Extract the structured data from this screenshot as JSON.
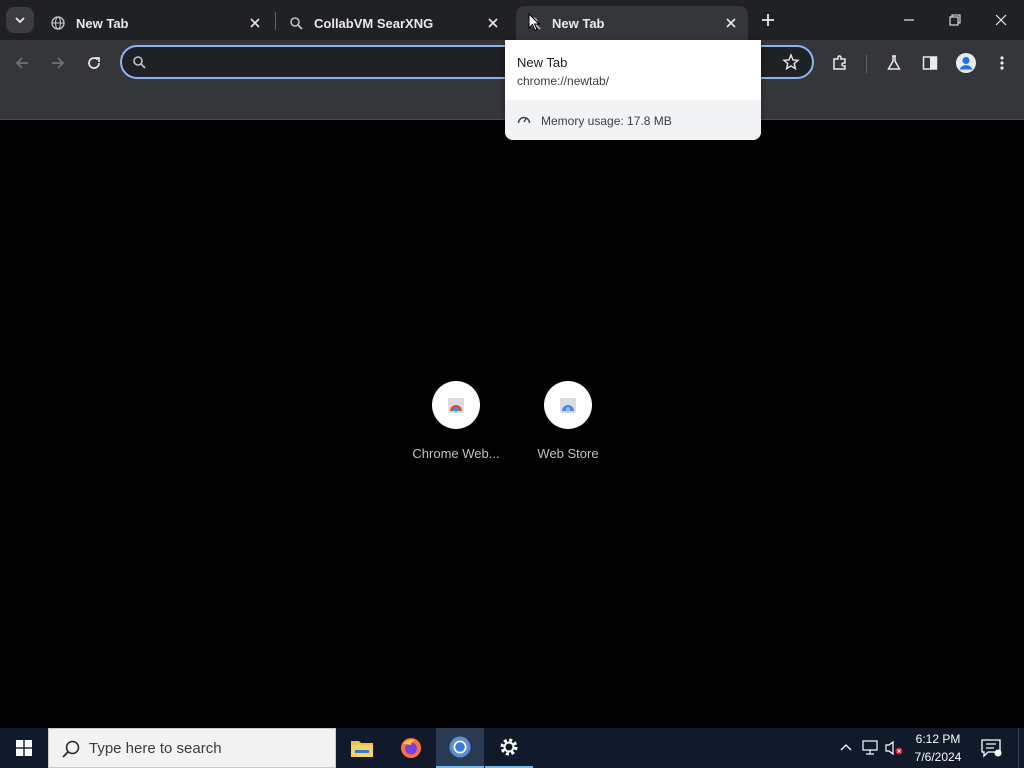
{
  "browser": {
    "tabs": [
      {
        "title": "New Tab",
        "favicon": "globe-icon",
        "active": false
      },
      {
        "title": "CollabVM SearXNG",
        "favicon": "searxng-icon",
        "active": false
      },
      {
        "title": "New Tab",
        "favicon": "searxng-icon",
        "active": true
      }
    ],
    "omnibox": {
      "value": "",
      "placeholder": ""
    },
    "hover_card": {
      "title": "New Tab",
      "url": "chrome://newtab/",
      "memory": "Memory usage: 17.8 MB"
    }
  },
  "newtab": {
    "shortcuts": [
      {
        "label": "Chrome Web...",
        "icon": "chrome-web-store-icon"
      },
      {
        "label": "Web Store",
        "icon": "web-store-icon"
      }
    ]
  },
  "taskbar": {
    "search_placeholder": "Type here to search",
    "time": "6:12 PM",
    "date": "7/6/2024",
    "apps": [
      "file-explorer-icon",
      "firefox-icon",
      "chrome-icon",
      "settings-icon"
    ]
  },
  "colors": {
    "accent": "#8ab4f8",
    "tabstrip": "#202124",
    "toolbar": "#35363a",
    "taskbar": "#101a2a"
  }
}
